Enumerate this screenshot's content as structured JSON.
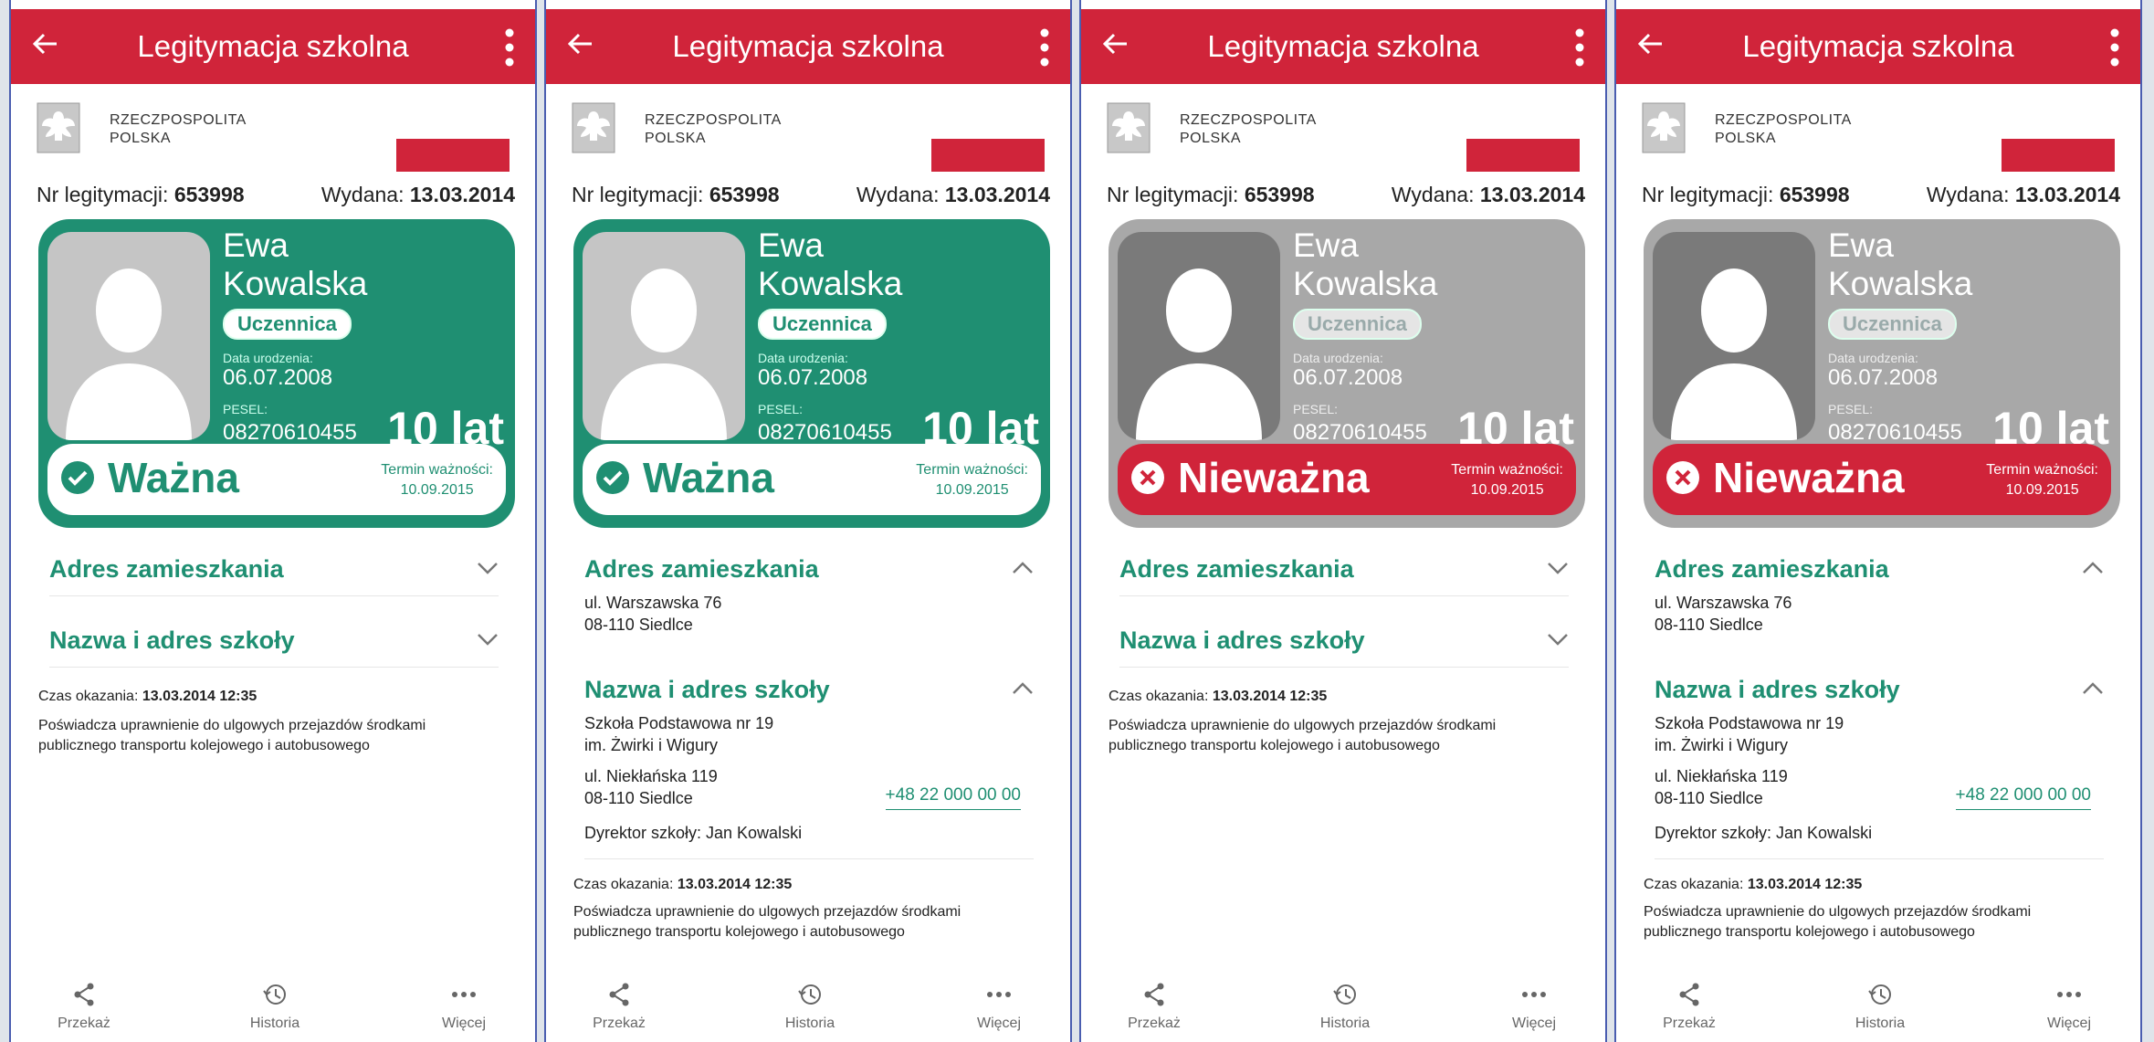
{
  "colors": {
    "accent_red": "#d0243a",
    "valid_green": "#1f8f72",
    "invalid_grey": "#a8a8a8"
  },
  "appbar": {
    "title": "Legitymacja szkolna",
    "back_icon": "arrow-left-icon",
    "menu_icon": "more-vert-icon"
  },
  "header": {
    "line1": "RZECZPOSPOLITA",
    "line2": "POLSKA",
    "emblem_icon": "eagle-emblem-icon"
  },
  "meta": {
    "nr_label": "Nr legitymacji: ",
    "nr_value": "653998",
    "wydana_label": "Wydana: ",
    "wydana_value": "13.03.2014"
  },
  "person": {
    "first_name": "Ewa",
    "last_name": "Kowalska",
    "role": "Uczennica",
    "dob_label": "Data urodzenia:",
    "dob": "06.07.2008",
    "pesel_label": "PESEL:",
    "pesel": "08270610455",
    "age": "10 lat"
  },
  "term": {
    "label": "Termin ważności:",
    "value": "10.09.2015"
  },
  "status": {
    "valid": "Ważna",
    "invalid": "Nieważna"
  },
  "sections": {
    "address_title": "Adres zamieszkania",
    "address_line1": "ul. Warszawska 76",
    "address_line2": "08-110 Siedlce",
    "school_title": "Nazwa i adres szkoły",
    "school_line1": "Szkoła Podstawowa nr 19",
    "school_line2": "im. Żwirki i Wigury",
    "school_line3": "ul. Niekłańska 119",
    "school_line4": "08-110 Siedlce",
    "school_phone": "+48 22 000 00 00",
    "director": "Dyrektor szkoły: Jan Kowalski"
  },
  "info": {
    "shown_label": "Czas okazania: ",
    "shown_value": "13.03.2014 12:35",
    "desc": "Poświadcza uprawnienie do ulgowych przejazdów środkami publicznego transportu kolejowego i autobusowego"
  },
  "bottom": {
    "share": "Przekaż",
    "history": "Historia",
    "more": "Więcej"
  },
  "panels": [
    {
      "status": "valid",
      "expanded": false
    },
    {
      "status": "valid",
      "expanded": true
    },
    {
      "status": "invalid",
      "expanded": false
    },
    {
      "status": "invalid",
      "expanded": true
    }
  ]
}
